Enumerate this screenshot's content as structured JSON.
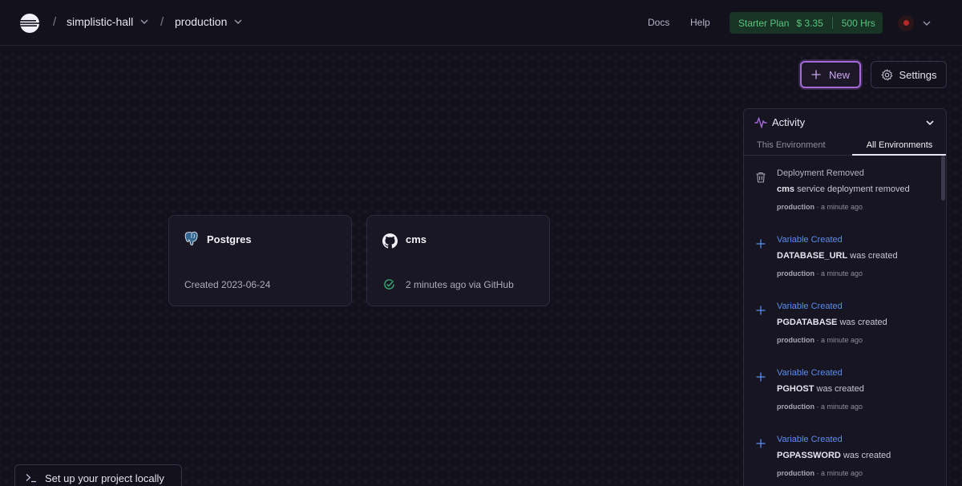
{
  "header": {
    "project_name": "simplistic-hall",
    "environment_name": "production",
    "separator": "/",
    "docs_label": "Docs",
    "help_label": "Help",
    "plan": {
      "name": "Starter Plan",
      "credit": "$ 3.35",
      "hours": "500 Hrs"
    }
  },
  "toolbar": {
    "new_label": "New",
    "settings_label": "Settings"
  },
  "services": [
    {
      "name": "Postgres",
      "status": "Created 2023-06-24",
      "icon": "postgres-icon"
    },
    {
      "name": "cms",
      "status": "2 minutes ago via GitHub",
      "icon": "github-icon",
      "status_icon": "check-circle-icon"
    }
  ],
  "activity": {
    "title": "Activity",
    "tabs": [
      "This Environment",
      "All Environments"
    ],
    "active_tab": "All Environments",
    "items": [
      {
        "title": "Deployment Removed",
        "subject": "cms",
        "text": "service deployment removed",
        "env": "production",
        "time": "· a minute ago",
        "icon": "trash-icon"
      },
      {
        "title": "Variable Created",
        "subject": "DATABASE_URL",
        "text": "was created",
        "env": "production",
        "time": "· a minute ago",
        "icon": "plus-icon"
      },
      {
        "title": "Variable Created",
        "subject": "PGDATABASE",
        "text": "was created",
        "env": "production",
        "time": "· a minute ago",
        "icon": "plus-icon"
      },
      {
        "title": "Variable Created",
        "subject": "PGHOST",
        "text": "was created",
        "env": "production",
        "time": "· a minute ago",
        "icon": "plus-icon"
      },
      {
        "title": "Variable Created",
        "subject": "PGPASSWORD",
        "text": "was created",
        "env": "production",
        "time": "· a minute ago",
        "icon": "plus-icon"
      }
    ]
  },
  "footer": {
    "local_setup_label": "Set up your project locally"
  },
  "colors": {
    "background": "#13111c",
    "accent_purple": "#a56ad8",
    "plan_green": "#59c47f",
    "activity_blue": "#5b8def",
    "success_green": "#3fb37a"
  }
}
